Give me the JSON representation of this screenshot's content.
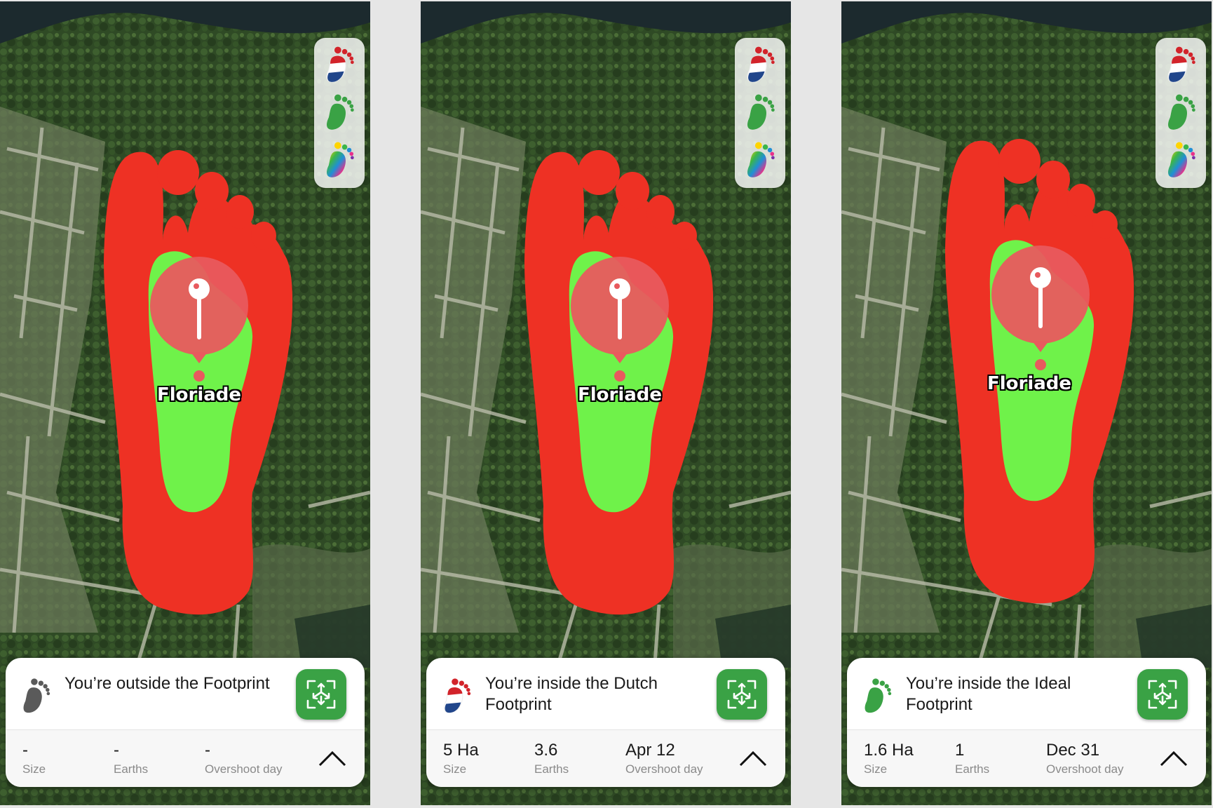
{
  "screens": [
    {
      "place_label": "Floriade",
      "status": "You’re outside the Footprint",
      "status_icon": "gray-footprint-icon",
      "stats": [
        {
          "value": "-",
          "label": "Size"
        },
        {
          "value": "-",
          "label": "Earths"
        },
        {
          "value": "-",
          "label": "Overshoot day"
        }
      ]
    },
    {
      "place_label": "Floriade",
      "status": "You’re inside the Dutch Footprint",
      "status_icon": "dutch-flag-footprint-icon",
      "stats": [
        {
          "value": "5 Ha",
          "label": "Size"
        },
        {
          "value": "3.6",
          "label": "Earths"
        },
        {
          "value": "Apr 12",
          "label": "Overshoot day"
        }
      ]
    },
    {
      "place_label": "Floriade",
      "status": "You’re inside the Ideal Footprint",
      "status_icon": "green-footprint-icon",
      "stats": [
        {
          "value": "1.6 Ha",
          "label": "Size"
        },
        {
          "value": "1",
          "label": "Earths"
        },
        {
          "value": "Dec 31",
          "label": "Overshoot day"
        }
      ]
    }
  ],
  "layer_buttons": [
    "dutch-flag-footprint-icon",
    "green-footprint-icon",
    "rainbow-footprint-icon"
  ],
  "colors": {
    "outer_footprint": "#ee3124",
    "inner_footprint": "#6ff24a",
    "pin_circle": "#e85a5e",
    "locate_button": "#3aa245"
  }
}
